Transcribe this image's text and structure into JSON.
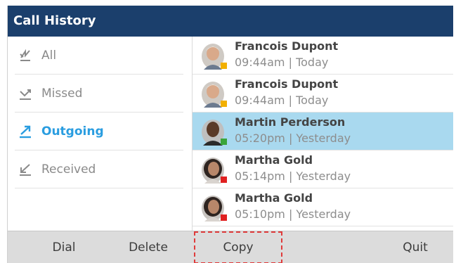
{
  "title": "Call History",
  "sidebar": {
    "items": [
      {
        "label": "All",
        "icon": "all-calls-icon",
        "active": false
      },
      {
        "label": "Missed",
        "icon": "missed-call-icon",
        "active": false
      },
      {
        "label": "Outgoing",
        "icon": "outgoing-call-icon",
        "active": true
      },
      {
        "label": "Received",
        "icon": "received-call-icon",
        "active": false
      }
    ]
  },
  "calls": [
    {
      "name": "Francois Dupont",
      "time": "09:44am | Today",
      "status_color": "#f2b000",
      "selected": false
    },
    {
      "name": "Francois Dupont",
      "time": "09:44am | Today",
      "status_color": "#f2b000",
      "selected": false
    },
    {
      "name": "Martin Perderson",
      "time": "05:20pm | Yesterday",
      "status_color": "#3aa53a",
      "selected": true
    },
    {
      "name": "Martha Gold",
      "time": "05:14pm | Yesterday",
      "status_color": "#e02020",
      "selected": false
    },
    {
      "name": "Martha Gold",
      "time": "05:10pm | Yesterday",
      "status_color": "#e02020",
      "selected": false
    }
  ],
  "softkeys": {
    "dial": "Dial",
    "delete": "Delete",
    "copy": "Copy",
    "quit": "Quit"
  },
  "colors": {
    "titlebar": "#1b3f6c",
    "accent": "#2a9de0",
    "selected_row": "#a9d9ef"
  }
}
